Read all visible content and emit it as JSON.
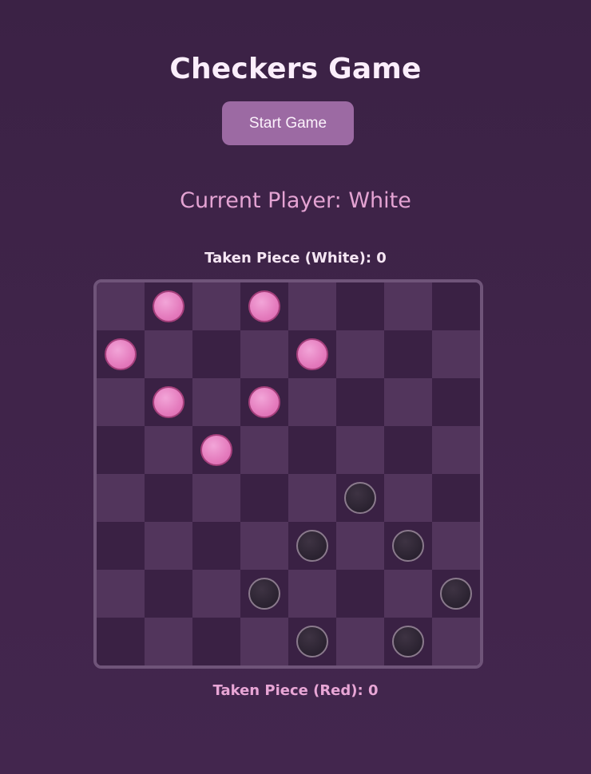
{
  "title": "Checkers Game",
  "start_button": "Start Game",
  "current_player": "Current Player: White",
  "taken_white": "Taken Piece (White): 0",
  "taken_red": "Taken Piece (Red): 0",
  "board": {
    "size": 8,
    "light_square_color": "#52355c",
    "dark_square_color": "#3a2144",
    "pink_piece_color": "#e47bbd",
    "dark_piece_color": "#2a2230",
    "pieces": [
      {
        "row": 0,
        "col": 1,
        "color": "pink"
      },
      {
        "row": 0,
        "col": 3,
        "color": "pink"
      },
      {
        "row": 1,
        "col": 0,
        "color": "pink"
      },
      {
        "row": 1,
        "col": 4,
        "color": "pink"
      },
      {
        "row": 2,
        "col": 1,
        "color": "pink"
      },
      {
        "row": 2,
        "col": 3,
        "color": "pink"
      },
      {
        "row": 3,
        "col": 2,
        "color": "pink"
      },
      {
        "row": 4,
        "col": 5,
        "color": "black"
      },
      {
        "row": 5,
        "col": 4,
        "color": "black"
      },
      {
        "row": 5,
        "col": 6,
        "color": "black"
      },
      {
        "row": 6,
        "col": 3,
        "color": "black"
      },
      {
        "row": 6,
        "col": 7,
        "color": "black"
      },
      {
        "row": 7,
        "col": 4,
        "color": "black"
      },
      {
        "row": 7,
        "col": 6,
        "color": "black"
      }
    ]
  }
}
